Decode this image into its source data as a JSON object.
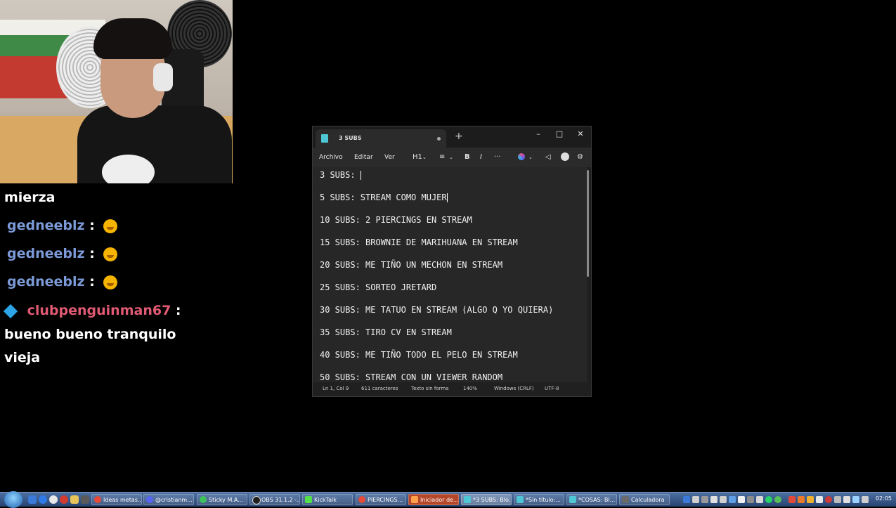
{
  "chat": {
    "line0_text": "mierza",
    "line1_user": "gedneeblz",
    "line2_user": "gedneeblz",
    "line3_user": "gedneeblz",
    "separator": ":",
    "line4_user": "clubpenguinman67",
    "line4_sep": ":",
    "line5_text": "bueno bueno tranquilo",
    "line6_text": "vieja"
  },
  "notepad": {
    "tab_title": "3 SUBS",
    "new_tab": "+",
    "minimize": "–",
    "maximize": "□",
    "close": "✕",
    "menu": {
      "file": "Archivo",
      "edit": "Editar",
      "view": "Ver"
    },
    "toolbar": {
      "heading": "H1",
      "list": "≡",
      "bold": "B",
      "italic": "I",
      "more": "···"
    },
    "lines": [
      "3 SUBS: ",
      "5 SUBS: STREAM COMO MUJER",
      "10 SUBS: 2 PIERCINGS EN STREAM",
      "15 SUBS: BROWNIE DE MARIHUANA EN STREAM",
      "20 SUBS: ME TIÑO UN MECHON EN STREAM",
      "25 SUBS: SORTEO JRETARD",
      "30 SUBS: ME TATUO EN STREAM (ALGO Q YO QUIERA)",
      "35 SUBS: TIRO CV EN STREAM",
      "40 SUBS: ME TIÑO TODO EL PELO EN STREAM",
      "50 SUBS: STREAM CON UN VIEWER RANDOM"
    ],
    "status": {
      "position": "Ln 1, Col 9",
      "chars": "611 caracteres",
      "format": "Texto sin forma",
      "zoom": "140%",
      "line_ending": "Windows (CRLF)",
      "encoding": "UTF-8"
    }
  },
  "taskbar": {
    "tasks": [
      "Ideas metas...",
      "@cristianm...",
      "Sticky M.A...",
      "OBS 31.1.2 -...",
      "KickTalk",
      "PIERCINGS...",
      "Iniciador de...",
      "*3 SUBS: Blo...",
      "*Sin título:...",
      "*COSAS: Bl...",
      "Calculadora"
    ],
    "clock": "02:05"
  }
}
